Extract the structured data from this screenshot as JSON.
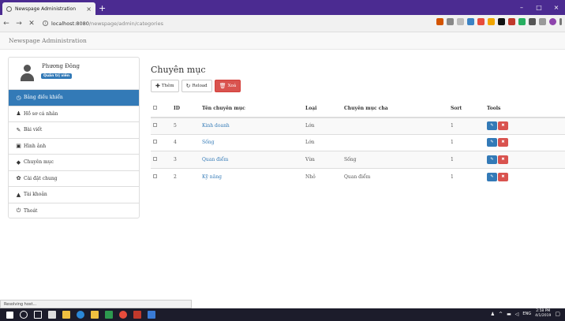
{
  "browser": {
    "tab_title": "Newspage Administration",
    "tab_close": "×",
    "new_tab": "+",
    "window_controls": [
      "–",
      "□",
      "×"
    ],
    "url_host": "localhost:8080",
    "url_path": "/newspage/admin/categories",
    "status_text": "Resolving host..."
  },
  "app": {
    "brand": "Newspage Administration"
  },
  "sidebar": {
    "user_name": "Phương Đông",
    "role_badge": "Quản trị viên",
    "items": [
      {
        "label": "Bảng điều khiển",
        "icon": "◷"
      },
      {
        "label": "Hồ sơ cá nhân",
        "icon": "♟"
      },
      {
        "label": "Bài viết",
        "icon": "✎"
      },
      {
        "label": "Hình ảnh",
        "icon": "▣"
      },
      {
        "label": "Chuyên mục",
        "icon": "◆"
      },
      {
        "label": "Cài đặt chung",
        "icon": "✿"
      },
      {
        "label": "Tài khoản",
        "icon": "▲"
      },
      {
        "label": "Thoát",
        "icon": "⏻"
      }
    ]
  },
  "page": {
    "title": "Chuyên mục",
    "toolbar": {
      "add_label": "Thêm",
      "reload_label": "Reload",
      "delete_label": "Xoá"
    },
    "table": {
      "headers": {
        "id": "ID",
        "name": "Tên chuyên mục",
        "type": "Loại",
        "parent": "Chuyên mục cha",
        "sort": "Sort",
        "tools": "Tools"
      },
      "rows": [
        {
          "id": "5",
          "name": "Kinh doanh",
          "type": "Lớn",
          "parent": "",
          "sort": "1"
        },
        {
          "id": "4",
          "name": "Sống",
          "type": "Lớn",
          "parent": "",
          "sort": "1"
        },
        {
          "id": "3",
          "name": "Quan điểm",
          "type": "Vừa",
          "parent": "Sống",
          "sort": "1"
        },
        {
          "id": "2",
          "name": "Kỹ năng",
          "type": "Nhỏ",
          "parent": "Quan điểm",
          "sort": "1"
        }
      ]
    }
  },
  "taskbar": {
    "language": "ENG",
    "time": "2:58 PM",
    "date": "4/1/2019"
  }
}
